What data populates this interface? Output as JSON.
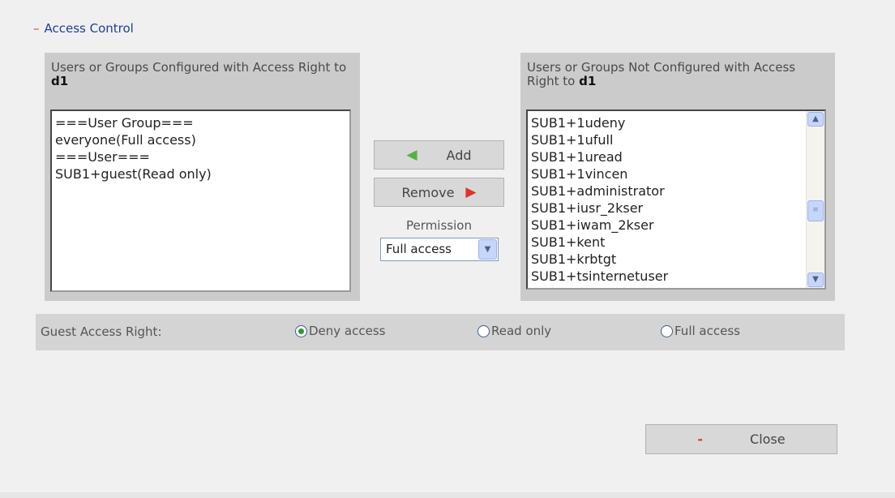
{
  "section": {
    "minus": "–",
    "title": "Access Control"
  },
  "left_panel": {
    "header_prefix": "Users or Groups Configured with Access Right to",
    "header_target": "d1",
    "items": [
      "===User Group===",
      "everyone(Full access)",
      "===User===",
      "SUB1+guest(Read only)"
    ]
  },
  "right_panel": {
    "header_prefix": "Users or Groups Not Configured with Access Right to",
    "header_target": "d1",
    "items": [
      "SUB1+1udeny",
      "SUB1+1ufull",
      "SUB1+1uread",
      "SUB1+1vincen",
      "SUB1+administrator",
      "SUB1+iusr_2kser",
      "SUB1+iwam_2kser",
      "SUB1+kent",
      "SUB1+krbtgt",
      "SUB1+tsinternetuser"
    ]
  },
  "actions": {
    "add_label": "Add",
    "remove_label": "Remove",
    "permission_label": "Permission",
    "permission_value": "Full access"
  },
  "guest": {
    "label": "Guest Access Right:",
    "options": [
      "Deny access",
      "Read only",
      "Full access"
    ],
    "selected": "Deny access"
  },
  "close": {
    "minus": "-",
    "label": "Close"
  },
  "icons": {
    "add": "arrow-left-icon",
    "remove": "arrow-right-icon",
    "scroll_up": "scroll-up-icon",
    "scroll_down": "scroll-down-icon",
    "dropdown": "chevron-down-icon"
  },
  "colors": {
    "title": "#1f3f9a",
    "minus": "#e23a2b",
    "add_arrow": "#53b341",
    "remove_arrow": "#e2322a",
    "radio_dot": "#2b9a2b"
  }
}
